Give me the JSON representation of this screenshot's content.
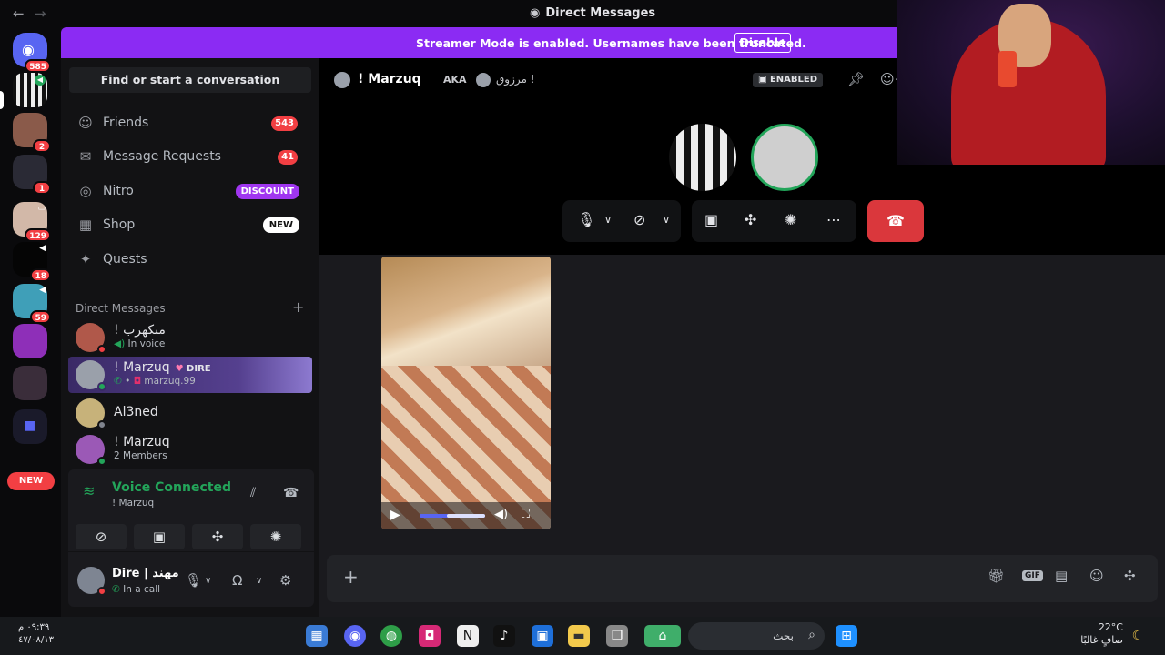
{
  "titlebar": {
    "title": "Direct Messages",
    "back": "←",
    "forward": "→"
  },
  "banner": {
    "message": "Streamer Mode is enabled. Usernames have been truncated.",
    "button": "Disable"
  },
  "rail": {
    "servers": [
      {
        "badge": "585"
      },
      {
        "badge": ""
      },
      {
        "badge": "2"
      },
      {
        "badge": "1"
      },
      {
        "badge": "129"
      },
      {
        "badge": "18"
      },
      {
        "badge": "59"
      },
      {
        "badge": ""
      },
      {
        "badge": ""
      }
    ],
    "new_label": "NEW"
  },
  "sidebar": {
    "search_placeholder": "Find or start a conversation",
    "nav": [
      {
        "label": "Friends",
        "count": "543"
      },
      {
        "label": "Message Requests",
        "count": "41"
      },
      {
        "label": "Nitro",
        "pill": "DISCOUNT"
      },
      {
        "label": "Shop",
        "pill": "NEW"
      },
      {
        "label": "Quests"
      }
    ],
    "dm_header": "Direct Messages",
    "dms": [
      {
        "name": "! متكهرب",
        "sub": "In voice"
      },
      {
        "name": "! Marzuq",
        "tag": "DIRE",
        "sub": "marzuq.99"
      },
      {
        "name": "Al3ned",
        "sub": ""
      },
      {
        "name": "! Marzuq",
        "sub": "2 Members"
      }
    ],
    "voice": {
      "title": "Voice Connected",
      "sub": "! Marzuq"
    },
    "user": {
      "name": "Dire | مهند",
      "status": "In a call"
    }
  },
  "main": {
    "header": {
      "name": "! Marzuq",
      "aka": "AKA",
      "nickname": "مرزوق !",
      "enabled": "ENABLED"
    }
  },
  "taskbar": {
    "time": "٠٩:٣٩ م",
    "date": "٤٧/٠٨/١٣",
    "search": "بحث",
    "temp": "22°C",
    "weather": "صافٍ غالبًا"
  },
  "colors": {
    "accent": "#8b2bf3",
    "danger": "#da373c",
    "online": "#23a55a"
  }
}
